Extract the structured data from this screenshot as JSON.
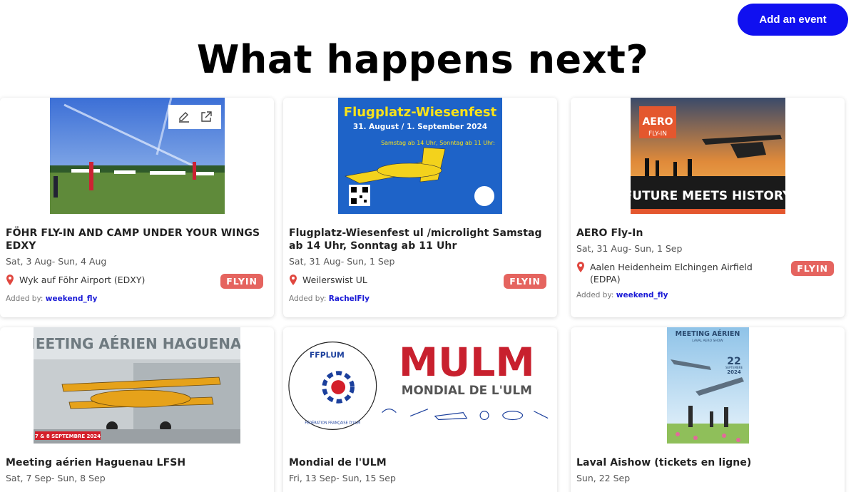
{
  "header": {
    "add_event_label": "Add an event",
    "title": "What happens next?"
  },
  "events": [
    {
      "title": "FÖHR FLY-IN AND CAMP UNDER YOUR WINGS EDXY",
      "dates": "Sat, 3 Aug- Sun, 4 Aug",
      "location": "Wyk auf Föhr Airport (EDXY)",
      "badge": "FLYIN",
      "added_by_label": "Added by:",
      "added_by": "weekend_fly"
    },
    {
      "title": "Flugplatz-Wiesenfest ul /microlight Samstag ab 14 Uhr, Sonntag ab 11 Uhr",
      "dates": "Sat, 31 Aug- Sun, 1 Sep",
      "location": "Weilerswist UL",
      "badge": "FLYIN",
      "added_by_label": "Added by:",
      "added_by": "RachelFly",
      "poster": {
        "headline": "Flugplatz-Wiesenfest",
        "dates": "31. August / 1. September 2024",
        "times": "Samstag ab 14 Uhr, Sonntag ab 11 Uhr:"
      }
    },
    {
      "title": "AERO Fly-In",
      "dates": "Sat, 31 Aug- Sun, 1 Sep",
      "location": "Aalen Heidenheim Elchingen Airfield (EDPA)",
      "badge": "FLYIN",
      "added_by_label": "Added by:",
      "added_by": "weekend_fly",
      "poster": {
        "logo_top": "AERO",
        "logo_bottom": "FLY-IN",
        "banner": "FUTURE MEETS HISTORY"
      }
    },
    {
      "title": "Meeting aérien Haguenau LFSH",
      "dates": "Sat, 7 Sep- Sun, 8 Sep",
      "poster": {
        "headline": "MEETING AÉRIEN HAGUENAU",
        "dates": "7 & 8 SEPTEMBRE 2024"
      }
    },
    {
      "title": "Mondial de l'ULM",
      "dates": "Fri, 13 Sep- Sun, 15 Sep",
      "poster": {
        "org": "FFPLUM",
        "org_full": "FÉDÉRATION FRANÇAISE D'ULM",
        "logo": "MULM",
        "subtitle": "MONDIAL DE L'ULM"
      }
    },
    {
      "title": "Laval Aishow (tickets en ligne)",
      "dates": "Sun, 22 Sep",
      "poster": {
        "headline": "MEETING AÉRIEN",
        "sub": "LAVAL AERO SHOW",
        "day": "22",
        "month": "SEPTEMBRE",
        "year": "2024"
      }
    }
  ],
  "colors": {
    "accent": "#1010f0",
    "badge": "#e5645f",
    "user_link": "#1a1ad6"
  },
  "icons": [
    "edit-icon",
    "external-link-icon",
    "location-pin-icon"
  ]
}
